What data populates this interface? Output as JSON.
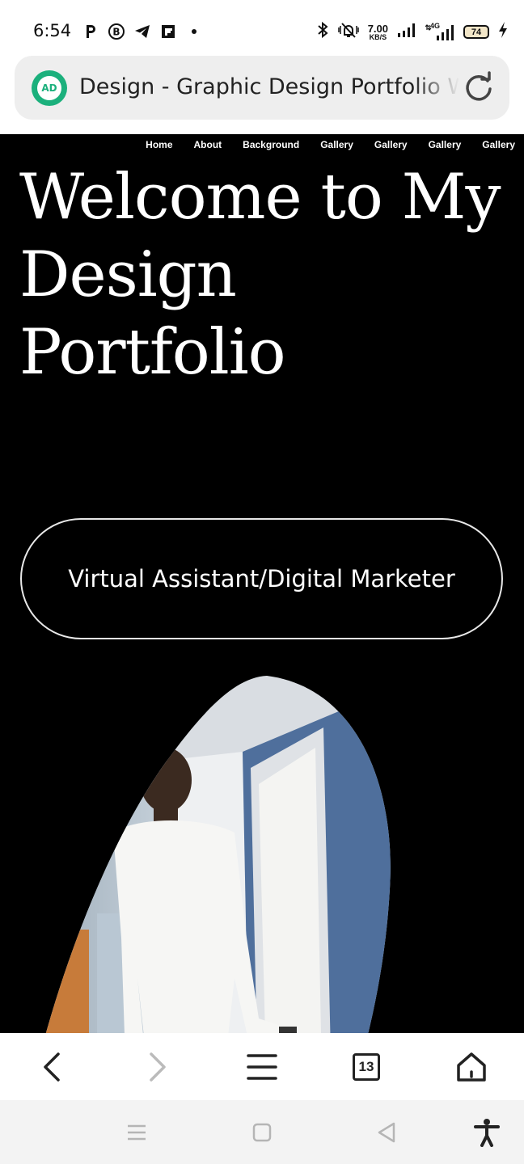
{
  "status_bar": {
    "time": "6:54",
    "net_speed_value": "7.00",
    "net_speed_unit": "KB/S",
    "network_type": "4G",
    "battery_level": "74",
    "left_icons": [
      "p-app-icon",
      "b-app-icon",
      "telegram-icon",
      "flipboard-icon",
      "dot-icon"
    ],
    "right_icons": [
      "bluetooth-icon",
      "mute-icon",
      "signal-icon",
      "signal-4g-icon",
      "battery-icon",
      "charging-icon"
    ]
  },
  "browser": {
    "site_badge": "AD",
    "page_title": "Design - Graphic Design Portfolio Website",
    "tab_count": "13",
    "accent_color": "#1bb07c"
  },
  "page": {
    "nav_items": [
      "Home",
      "About",
      "Background",
      "Gallery",
      "Gallery",
      "Gallery",
      "Gallery"
    ],
    "hero_title": "Welcome to My Design Portfolio",
    "role": "Virtual Assistant/Digital Marketer",
    "background_color": "#000000"
  }
}
